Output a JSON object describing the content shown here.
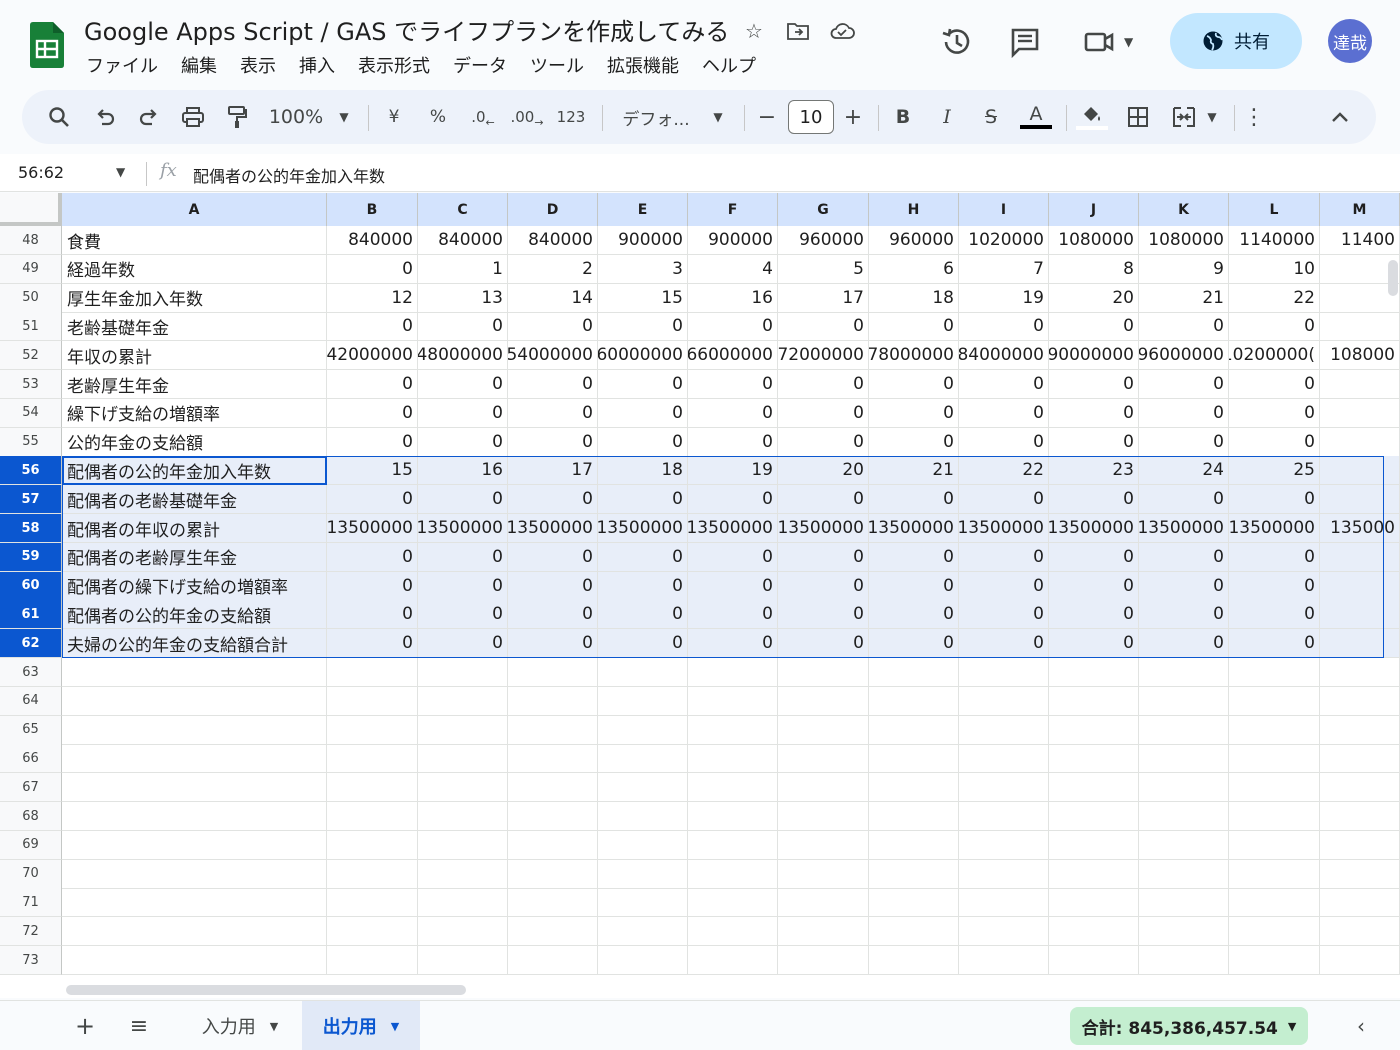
{
  "app": {
    "title": "Google Apps Script / GAS でライフプランを作成してみる",
    "menu": [
      "ファイル",
      "編集",
      "表示",
      "挿入",
      "表示形式",
      "データ",
      "ツール",
      "拡張機能",
      "ヘルプ"
    ],
    "share_label": "共有",
    "avatar_text": "達哉"
  },
  "toolbar": {
    "zoom": "100%",
    "currency": "¥",
    "percent": "%",
    "dec_decrease": ".0",
    "dec_increase": ".00",
    "number_format": "123",
    "font": "デフォ...",
    "font_size": "10",
    "bold": "B",
    "italic": "I",
    "strike": "S",
    "text_color": "A"
  },
  "formula_bar": {
    "name_box": "56:62",
    "fx": "fx",
    "content": "配偶者の公的年金加入年数"
  },
  "grid": {
    "columns": [
      "A",
      "B",
      "C",
      "D",
      "E",
      "F",
      "G",
      "H",
      "I",
      "J",
      "K",
      "L",
      "M"
    ],
    "rows": [
      {
        "num": "48",
        "label": "食費",
        "values": [
          "840000",
          "840000",
          "840000",
          "900000",
          "900000",
          "960000",
          "960000",
          "1020000",
          "1080000",
          "1080000",
          "1140000",
          "11400"
        ],
        "selected": false
      },
      {
        "num": "49",
        "label": "経過年数",
        "values": [
          "0",
          "1",
          "2",
          "3",
          "4",
          "5",
          "6",
          "7",
          "8",
          "9",
          "10",
          ""
        ],
        "selected": false
      },
      {
        "num": "50",
        "label": "厚生年金加入年数",
        "values": [
          "12",
          "13",
          "14",
          "15",
          "16",
          "17",
          "18",
          "19",
          "20",
          "21",
          "22",
          ""
        ],
        "selected": false
      },
      {
        "num": "51",
        "label": "老齢基礎年金",
        "values": [
          "0",
          "0",
          "0",
          "0",
          "0",
          "0",
          "0",
          "0",
          "0",
          "0",
          "0",
          ""
        ],
        "selected": false
      },
      {
        "num": "52",
        "label": "年収の累計",
        "values": [
          "42000000",
          "48000000",
          "54000000",
          "60000000",
          "66000000",
          "72000000",
          "78000000",
          "84000000",
          "90000000",
          "96000000",
          "10200000(",
          "108000"
        ],
        "selected": false
      },
      {
        "num": "53",
        "label": "老齢厚生年金",
        "values": [
          "0",
          "0",
          "0",
          "0",
          "0",
          "0",
          "0",
          "0",
          "0",
          "0",
          "0",
          ""
        ],
        "selected": false
      },
      {
        "num": "54",
        "label": "繰下げ支給の増額率",
        "values": [
          "0",
          "0",
          "0",
          "0",
          "0",
          "0",
          "0",
          "0",
          "0",
          "0",
          "0",
          ""
        ],
        "selected": false
      },
      {
        "num": "55",
        "label": "公的年金の支給額",
        "values": [
          "0",
          "0",
          "0",
          "0",
          "0",
          "0",
          "0",
          "0",
          "0",
          "0",
          "0",
          ""
        ],
        "selected": false
      },
      {
        "num": "56",
        "label": "配偶者の公的年金加入年数",
        "values": [
          "15",
          "16",
          "17",
          "18",
          "19",
          "20",
          "21",
          "22",
          "23",
          "24",
          "25",
          ""
        ],
        "selected": true
      },
      {
        "num": "57",
        "label": "配偶者の老齢基礎年金",
        "values": [
          "0",
          "0",
          "0",
          "0",
          "0",
          "0",
          "0",
          "0",
          "0",
          "0",
          "0",
          ""
        ],
        "selected": true
      },
      {
        "num": "58",
        "label": "配偶者の年収の累計",
        "values": [
          "13500000",
          "13500000",
          "13500000",
          "13500000",
          "13500000",
          "13500000",
          "13500000",
          "13500000",
          "13500000",
          "13500000",
          "13500000",
          "135000"
        ],
        "selected": true
      },
      {
        "num": "59",
        "label": "配偶者の老齢厚生年金",
        "values": [
          "0",
          "0",
          "0",
          "0",
          "0",
          "0",
          "0",
          "0",
          "0",
          "0",
          "0",
          ""
        ],
        "selected": true
      },
      {
        "num": "60",
        "label": "配偶者の繰下げ支給の増額率",
        "values": [
          "0",
          "0",
          "0",
          "0",
          "0",
          "0",
          "0",
          "0",
          "0",
          "0",
          "0",
          ""
        ],
        "selected": true
      },
      {
        "num": "61",
        "label": "配偶者の公的年金の支給額",
        "values": [
          "0",
          "0",
          "0",
          "0",
          "0",
          "0",
          "0",
          "0",
          "0",
          "0",
          "0",
          ""
        ],
        "selected": true
      },
      {
        "num": "62",
        "label": "夫婦の公的年金の支給額合計",
        "values": [
          "0",
          "0",
          "0",
          "0",
          "0",
          "0",
          "0",
          "0",
          "0",
          "0",
          "0",
          ""
        ],
        "selected": true
      },
      {
        "num": "63",
        "label": "",
        "values": [],
        "selected": false
      },
      {
        "num": "64",
        "label": "",
        "values": [],
        "selected": false
      },
      {
        "num": "65",
        "label": "",
        "values": [],
        "selected": false
      },
      {
        "num": "66",
        "label": "",
        "values": [],
        "selected": false
      },
      {
        "num": "67",
        "label": "",
        "values": [],
        "selected": false
      },
      {
        "num": "68",
        "label": "",
        "values": [],
        "selected": false
      },
      {
        "num": "69",
        "label": "",
        "values": [],
        "selected": false
      },
      {
        "num": "70",
        "label": "",
        "values": [],
        "selected": false
      },
      {
        "num": "71",
        "label": "",
        "values": [],
        "selected": false
      },
      {
        "num": "72",
        "label": "",
        "values": [],
        "selected": false
      },
      {
        "num": "73",
        "label": "",
        "values": [],
        "selected": false
      }
    ]
  },
  "sheets": {
    "tabs": [
      {
        "label": "入力用",
        "active": false
      },
      {
        "label": "出力用",
        "active": true
      }
    ],
    "sum": "合計: 845,386,457.54"
  },
  "colors": {
    "accent": "#0b57d0",
    "selection_fill": "#e8eef9",
    "share_bg": "#c2e7ff",
    "sum_bg": "#c4eed0",
    "logo": "#188038"
  }
}
